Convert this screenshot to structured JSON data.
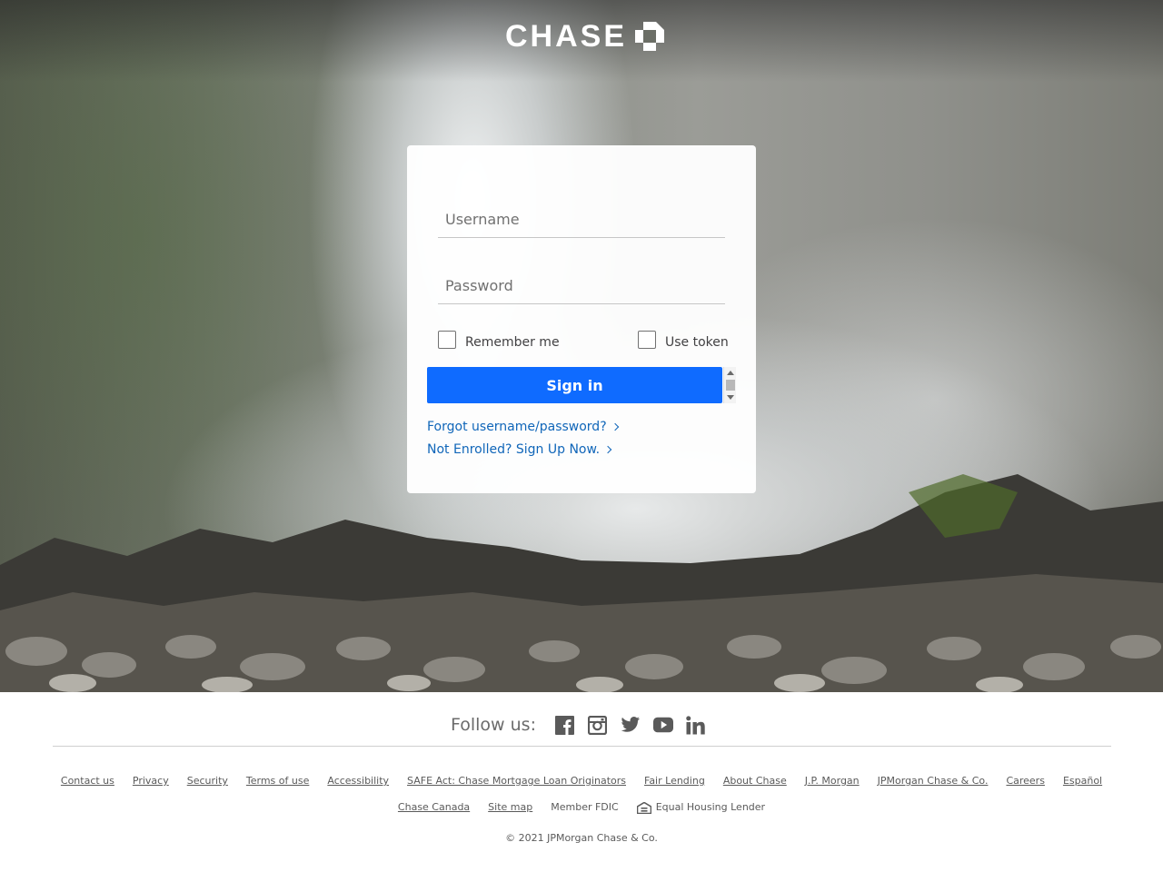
{
  "brand": {
    "name": "CHASE"
  },
  "login": {
    "username_placeholder": "Username",
    "password_placeholder": "Password",
    "remember_label": "Remember me",
    "token_label": "Use token",
    "signin_label": "Sign in",
    "forgot_link": "Forgot username/password?",
    "enroll_link": "Not Enrolled? Sign Up Now."
  },
  "footer": {
    "follow_label": "Follow us:",
    "social_icons": [
      "facebook-icon",
      "instagram-icon",
      "twitter-icon",
      "youtube-icon",
      "linkedin-icon"
    ],
    "links_row1": [
      "Contact us",
      "Privacy",
      "Security",
      "Terms of use",
      "Accessibility",
      "SAFE Act: Chase Mortgage Loan Originators",
      "Fair Lending",
      "About Chase",
      "J.P. Morgan",
      "JPMorgan Chase & Co.",
      "Careers",
      "Español"
    ],
    "links_row2": [
      "Chase Canada",
      "Site map"
    ],
    "member_fdic": "Member FDIC",
    "equal_housing": "Equal Housing Lender",
    "copyright": "© 2021 JPMorgan Chase & Co."
  },
  "colors": {
    "signin_button": "#0f6bff",
    "link": "#1066b9",
    "footer_text": "#5a5a5a"
  }
}
